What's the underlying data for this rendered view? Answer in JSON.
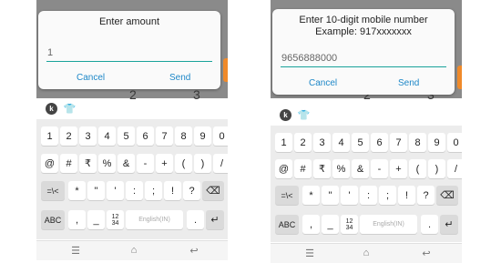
{
  "left_screen": {
    "dialog": {
      "title": "Enter amount",
      "input_value": "1",
      "cancel_label": "Cancel",
      "send_label": "Send"
    },
    "backdrop_digits": [
      "2",
      "3"
    ]
  },
  "right_screen": {
    "dialog": {
      "title_line1": "Enter 10-digit mobile number",
      "title_line2": "Example: 917xxxxxxx",
      "input_value": "9656888000",
      "cancel_label": "Cancel",
      "send_label": "Send"
    },
    "backdrop_digits": [
      "2",
      "3"
    ]
  },
  "keyboard": {
    "toolbar_icons": [
      "k-logo-icon",
      "shirt-icon"
    ],
    "number_row": [
      "1",
      "2",
      "3",
      "4",
      "5",
      "6",
      "7",
      "8",
      "9",
      "0"
    ],
    "symbol_row1": [
      "@",
      "#",
      "₹",
      "%",
      "&",
      "-",
      "+",
      "(",
      ")",
      "/"
    ],
    "symbol_row2": [
      "=\\<",
      "*",
      "\"",
      "'",
      ":",
      ";",
      "!",
      "?",
      "⌫"
    ],
    "bottom_row": {
      "abc": "ABC",
      "comma": ",",
      "underscore": "_",
      "numpad": "12\n34",
      "space": "English(IN)",
      "period": ".",
      "enter": "↵"
    }
  },
  "navbar": {
    "recent": "☰",
    "home": "⌂",
    "back": "↩"
  },
  "colors": {
    "accent": "#1aa39a",
    "button_text": "#1e88c8",
    "tab_accent": "#f08a2a",
    "keyboard_bg": "#ececec"
  }
}
